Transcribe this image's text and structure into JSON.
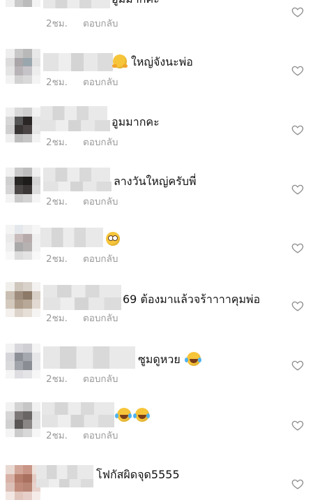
{
  "comments": [
    {
      "text": "อูมมากคะ",
      "emoji": "",
      "emoji_after": "",
      "time": "2ชม.",
      "reply": "ตอบกลับ"
    },
    {
      "text": "ใหญ่จังนะพ่อ",
      "emoji": "hugging-face",
      "emoji_after": "",
      "time": "2ชม.",
      "reply": "ตอบกลับ"
    },
    {
      "text": "อูมมากคะ",
      "emoji": "",
      "emoji_after": "",
      "time": "2ชม.",
      "reply": "ตอบกลับ"
    },
    {
      "text": "ลางวันใหญ่ครับพี่",
      "emoji": "",
      "emoji_after": "",
      "time": "2ชม.",
      "reply": "ตอบกลับ"
    },
    {
      "text": "",
      "emoji": "flushed-face",
      "emoji_after": "",
      "time": "2ชม.",
      "reply": "ตอบกลับ"
    },
    {
      "text": "69 ต้องมาแล้วจร้าาาาคุมพ่อ",
      "emoji": "",
      "emoji_after": "",
      "time": "2ชม.",
      "reply": "ตอบกลับ"
    },
    {
      "text": "ซูมดูหวย",
      "emoji": "",
      "emoji_after": "tears-of-joy-face",
      "time": "2ชม.",
      "reply": "ตอบกลับ"
    },
    {
      "text": "",
      "emoji": "tears-of-joy-face",
      "emoji_after": "tears-of-joy-face",
      "time": "2ชม.",
      "reply": "ตอบกลับ"
    },
    {
      "text": "โฟกัสผิดจุด5555",
      "emoji": "",
      "emoji_after": "",
      "time": "",
      "reply": ""
    }
  ]
}
